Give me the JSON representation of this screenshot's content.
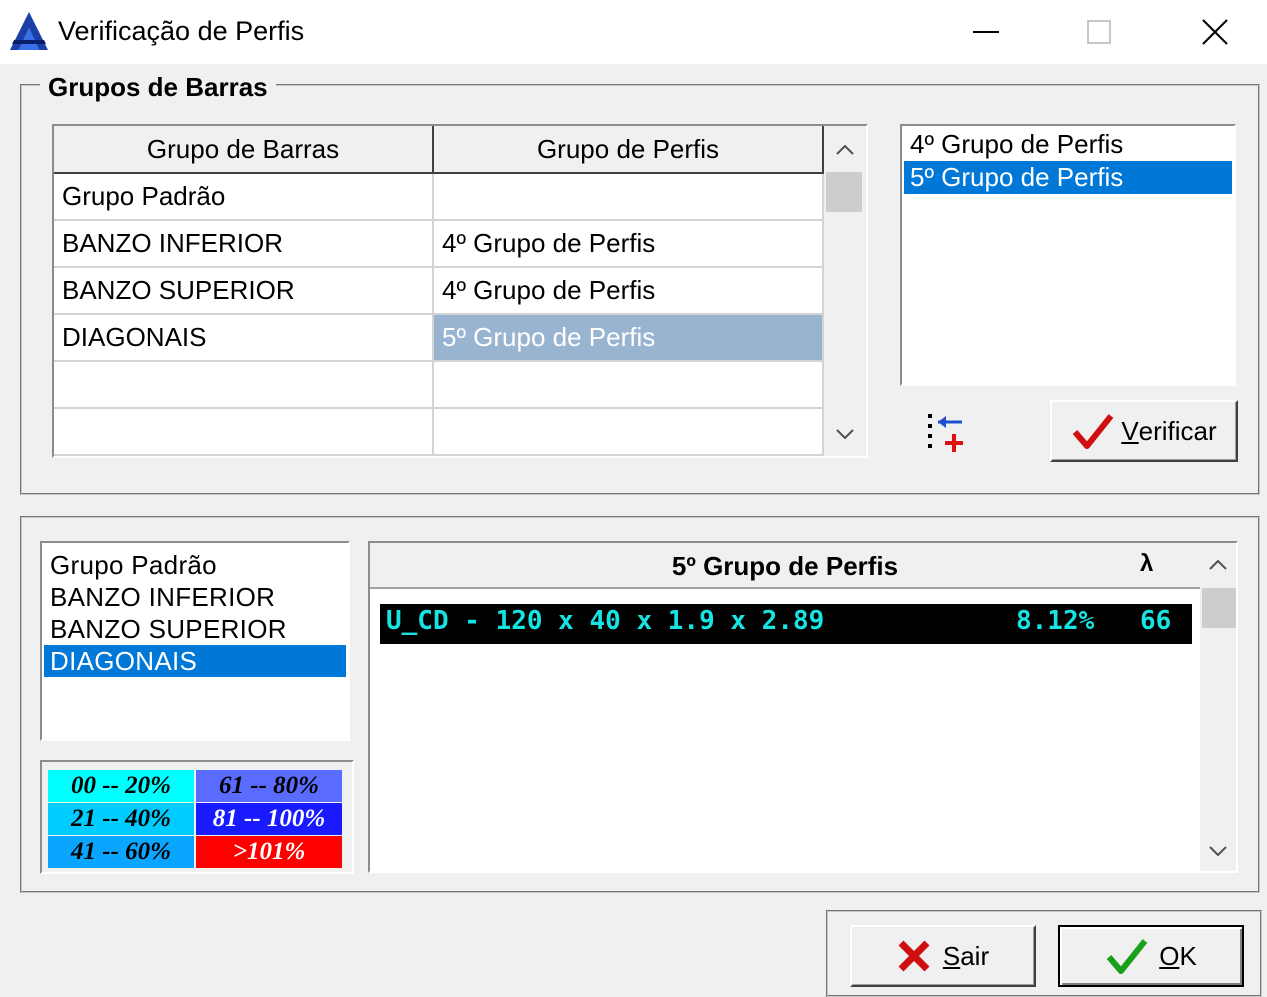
{
  "window": {
    "title": "Verificação de Perfis",
    "minimize_glyph": "—",
    "maximize_glyph": "☐",
    "close_glyph": "✕"
  },
  "groups_box": {
    "legend": "Grupos de Barras",
    "grid": {
      "headers": [
        "Grupo de Barras",
        "Grupo de Perfis"
      ],
      "rows": [
        [
          "Grupo Padrão",
          ""
        ],
        [
          "BANZO INFERIOR",
          "4º Grupo de Perfis"
        ],
        [
          "BANZO SUPERIOR",
          "4º Grupo de Perfis"
        ],
        [
          "DIAGONAIS",
          "5º Grupo de Perfis"
        ],
        [
          "",
          ""
        ],
        [
          "",
          ""
        ]
      ],
      "selected_row": 3,
      "scroll_up": "^",
      "scroll_down": "v"
    },
    "profiles_list": {
      "items": [
        "4º Grupo de Perfis",
        "5º Grupo de Perfis"
      ],
      "selected": 1
    },
    "verify_button": {
      "mnemonic": "V",
      "rest": "erificar"
    }
  },
  "bars_list": {
    "items": [
      "Grupo Padrão",
      "BANZO INFERIOR",
      "BANZO SUPERIOR",
      "DIAGONAIS"
    ],
    "selected": 3
  },
  "legend": {
    "ranges": [
      {
        "label": "00 -- 20%",
        "bg": "#00ffff",
        "fg": "#000000"
      },
      {
        "label": "61 -- 80%",
        "bg": "#5a6cff",
        "fg": "#000000"
      },
      {
        "label": "21 -- 40%",
        "bg": "#00ccff",
        "fg": "#000000"
      },
      {
        "label": "81 -- 100%",
        "bg": "#1a1aff",
        "fg": "#ffffff"
      },
      {
        "label": "41 -- 60%",
        "bg": "#0aa5ff",
        "fg": "#000000"
      },
      {
        "label": ">101%",
        "bg": "#ff0000",
        "fg": "#ffffff"
      }
    ]
  },
  "result": {
    "title": "5º Grupo de Perfis",
    "lambda_label": "λ",
    "profile": "U_CD - 120 x 40 x 1.9 x 2.89",
    "percent": "8.12%",
    "lambda_value": "66"
  },
  "buttons": {
    "exit": {
      "mnemonic": "S",
      "rest": "air"
    },
    "ok": {
      "mnemonic": "O",
      "rest": "K"
    }
  },
  "colors": {
    "selection": "#0078d7",
    "grid_selection": "#99b4d1",
    "result_text": "#17e3e3"
  }
}
